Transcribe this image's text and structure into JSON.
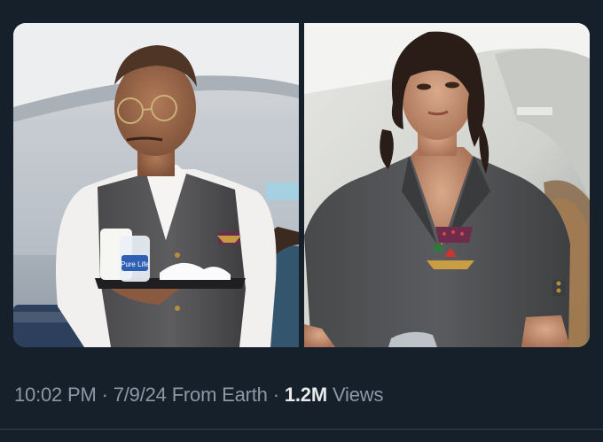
{
  "tweet": {
    "media": [
      {
        "name": "photo-male-flight-attendant",
        "bottle_label": "Pure Life"
      },
      {
        "name": "photo-female-flight-attendant"
      }
    ],
    "meta": {
      "time": "10:02 PM",
      "date": "7/9/24",
      "source": "From Earth",
      "separator": "·",
      "views_count": "1.2M",
      "views_label": "Views"
    }
  },
  "colors": {
    "background": "#15202b",
    "meta_text": "#8b98a5",
    "views_text": "#e7e9ea",
    "divider": "#38444d"
  }
}
